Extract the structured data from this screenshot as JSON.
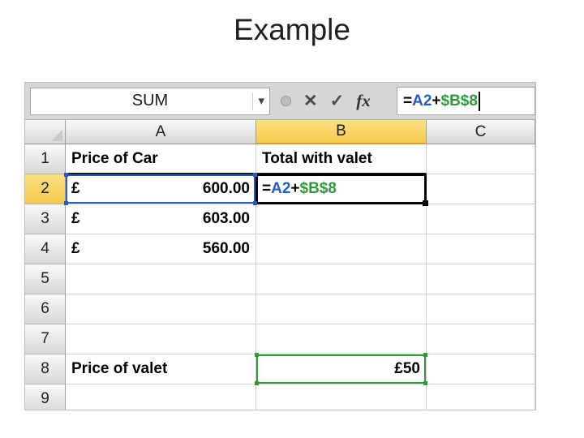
{
  "slide": {
    "title": "Example"
  },
  "formula_bar": {
    "name_box_value": "SUM",
    "formula_parts": [
      {
        "text": "=",
        "color": "#000000"
      },
      {
        "text": "A2",
        "color": "#2A5BC3"
      },
      {
        "text": "+",
        "color": "#000000"
      },
      {
        "text": "$B$8",
        "color": "#2E9939"
      }
    ],
    "icons": {
      "dropdown": "▾",
      "cancel": "✕",
      "enter": "✓",
      "insert_function": "fx"
    }
  },
  "colors": {
    "reference_blue": "#2A5BC3",
    "reference_green": "#2E9939",
    "active_cell_border": "#000000",
    "selected_header_fill": "#F8D468"
  },
  "sheet": {
    "columns": [
      "A",
      "B",
      "C"
    ],
    "rows": [
      {
        "num": "1",
        "a": "Price of Car",
        "b": "Total with valet"
      },
      {
        "num": "2",
        "a_symbol": "£",
        "a_amount": "600.00"
      },
      {
        "num": "3",
        "a_symbol": "£",
        "a_amount": "603.00"
      },
      {
        "num": "4",
        "a_symbol": "£",
        "a_amount": "560.00"
      },
      {
        "num": "5"
      },
      {
        "num": "6"
      },
      {
        "num": "7"
      },
      {
        "num": "8",
        "a": "Price of valet",
        "b": "£50"
      },
      {
        "num": "9"
      }
    ]
  }
}
